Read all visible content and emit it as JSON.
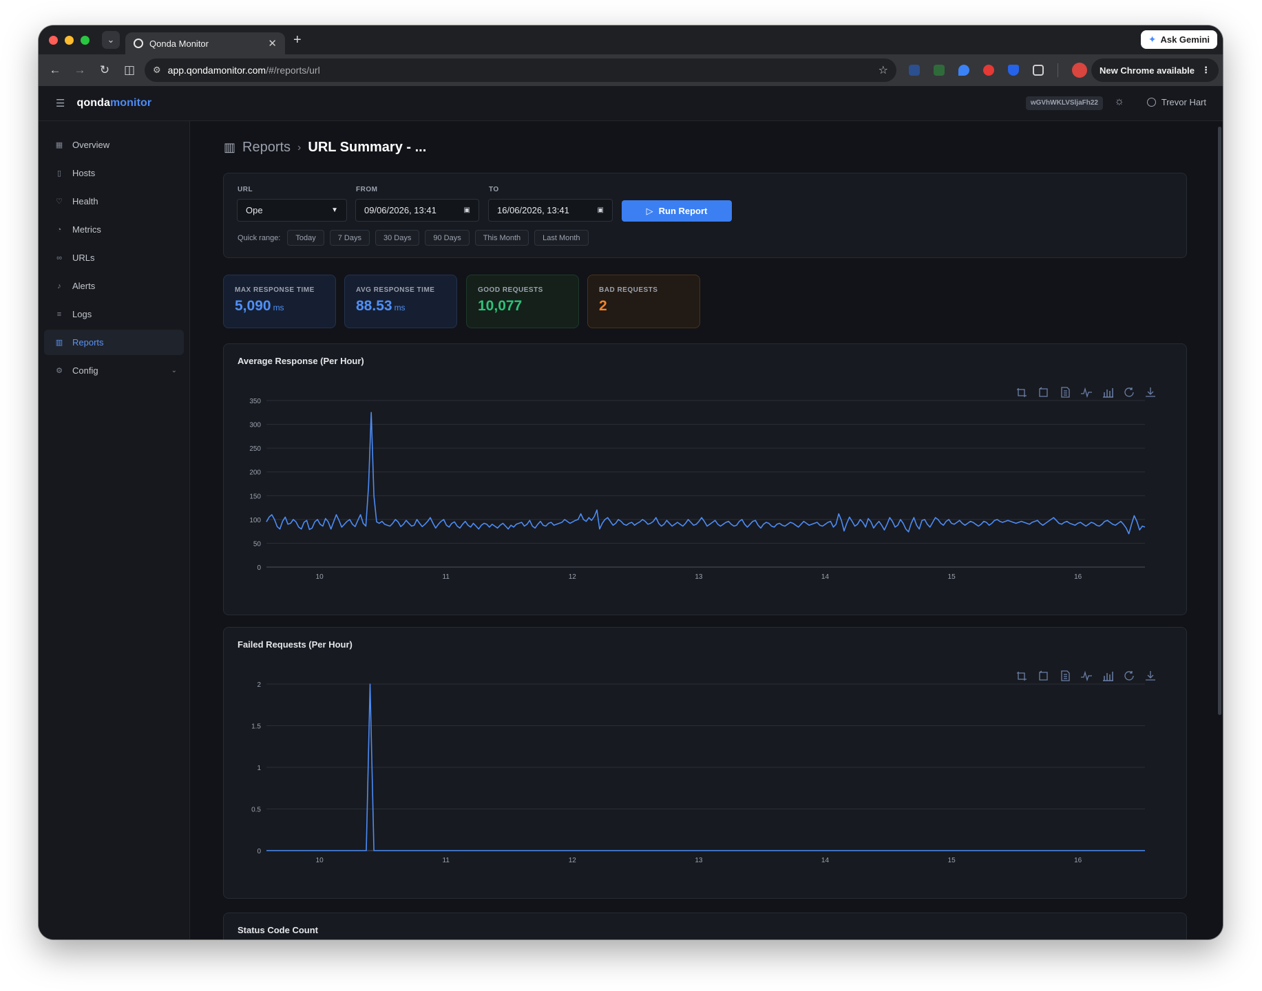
{
  "browser": {
    "tab_title": "Qonda Monitor",
    "url_host": "app.qondamonitor.com",
    "url_path": "/#/reports/url",
    "ask_gemini": "Ask Gemini",
    "new_chrome": "New Chrome available"
  },
  "app": {
    "brand_main": "qonda",
    "brand_accent": "monitor",
    "api_key": "wGVhWKLVSljaFh22",
    "user_name": "Trevor Hart"
  },
  "sidebar": {
    "items": [
      {
        "label": "Overview",
        "icon": "grid-icon"
      },
      {
        "label": "Hosts",
        "icon": "server-icon"
      },
      {
        "label": "Health",
        "icon": "heart-icon"
      },
      {
        "label": "Metrics",
        "icon": "gauge-icon"
      },
      {
        "label": "URLs",
        "icon": "link-icon"
      },
      {
        "label": "Alerts",
        "icon": "bell-icon"
      },
      {
        "label": "Logs",
        "icon": "list-icon"
      },
      {
        "label": "Reports",
        "icon": "bar-chart-icon",
        "active": true
      },
      {
        "label": "Config",
        "icon": "gear-icon"
      }
    ]
  },
  "page": {
    "crumb": "Reports",
    "title": "URL Summary - ..."
  },
  "filters": {
    "url_label": "URL",
    "url_value": "Ope",
    "from_label": "FROM",
    "from_value": "09/06/2026, 13:41",
    "to_label": "TO",
    "to_value": "16/06/2026, 13:41",
    "run_label": "Run Report",
    "quick_label": "Quick range:",
    "quick_ranges": [
      "Today",
      "7 Days",
      "30 Days",
      "90 Days",
      "This Month",
      "Last Month"
    ]
  },
  "stats": [
    {
      "label": "MAX RESPONSE TIME",
      "value": "5,090",
      "unit": "ms"
    },
    {
      "label": "AVG RESPONSE TIME",
      "value": "88.53",
      "unit": "ms"
    },
    {
      "label": "GOOD REQUESTS",
      "value": "10,077",
      "unit": ""
    },
    {
      "label": "BAD REQUESTS",
      "value": "2",
      "unit": ""
    }
  ],
  "colors": {
    "accent": "#3b7ff2",
    "line": "#4d8bf5",
    "good": "#2fc17a",
    "bad": "#f5832b"
  },
  "chart_data": [
    {
      "type": "line",
      "title": "Average Response (Per Hour)",
      "x_ticks": [
        "10",
        "11",
        "12",
        "13",
        "14",
        "15",
        "16"
      ],
      "ylim": [
        0,
        350
      ],
      "y_ticks": [
        0,
        50,
        100,
        150,
        200,
        250,
        300,
        350
      ],
      "grid": true,
      "x_start_day": 9.58,
      "x_end_day": 16.53,
      "series": [
        {
          "values": [
            95,
            105,
            110,
            100,
            85,
            80,
            96,
            105,
            90,
            92,
            100,
            95,
            84,
            80,
            94,
            98,
            79,
            82,
            95,
            100,
            90,
            86,
            102,
            95,
            80,
            95,
            110,
            98,
            84,
            90,
            96,
            100,
            90,
            85,
            98,
            110,
            92,
            86,
            170,
            325,
            150,
            95,
            92,
            96,
            90,
            88,
            86,
            92,
            100,
            95,
            85,
            90,
            98,
            92,
            86,
            88,
            100,
            92,
            85,
            90,
            96,
            104,
            92,
            82,
            90,
            96,
            100,
            88,
            84,
            92,
            95,
            86,
            82,
            90,
            96,
            88,
            84,
            92,
            86,
            80,
            88,
            92,
            90,
            84,
            90,
            86,
            82,
            88,
            92,
            86,
            80,
            88,
            84,
            90,
            92,
            94,
            86,
            90,
            98,
            86,
            82,
            90,
            96,
            88,
            86,
            92,
            94,
            88,
            90,
            92,
            94,
            100,
            96,
            92,
            95,
            98,
            100,
            112,
            100,
            96,
            104,
            98,
            106,
            120,
            80,
            92,
            100,
            104,
            96,
            88,
            92,
            100,
            96,
            90,
            88,
            92,
            94,
            88,
            92,
            95,
            100,
            96,
            90,
            92,
            96,
            104,
            92,
            86,
            90,
            98,
            92,
            86,
            90,
            94,
            90,
            86,
            92,
            100,
            94,
            88,
            90,
            96,
            104,
            96,
            86,
            90,
            94,
            98,
            90,
            86,
            90,
            94,
            96,
            90,
            86,
            88,
            96,
            100,
            90,
            84,
            90,
            96,
            98,
            88,
            82,
            90,
            94,
            92,
            86,
            84,
            90,
            92,
            88,
            86,
            90,
            94,
            92,
            88,
            84,
            90,
            96,
            92,
            88,
            90,
            92,
            94,
            88,
            86,
            90,
            94,
            96,
            84,
            90,
            112,
            98,
            76,
            92,
            105,
            96,
            86,
            90,
            100,
            94,
            84,
            102,
            95,
            82,
            90,
            96,
            88,
            78,
            90,
            104,
            96,
            84,
            88,
            100,
            92,
            80,
            74,
            92,
            104,
            88,
            80,
            98,
            100,
            90,
            84,
            94,
            104,
            100,
            92,
            88,
            96,
            100,
            92,
            90,
            94,
            98,
            92,
            88,
            92,
            96,
            94,
            90,
            86,
            90,
            96,
            94,
            88,
            92,
            98,
            100,
            96,
            94,
            96,
            98,
            96,
            94,
            92,
            94,
            96,
            94,
            92,
            90,
            94,
            96,
            98,
            92,
            88,
            92,
            96,
            100,
            104,
            98,
            92,
            90,
            94,
            96,
            92,
            90,
            88,
            92,
            94,
            90,
            86,
            90,
            94,
            92,
            88,
            86,
            90,
            96,
            98,
            94,
            90,
            88,
            92,
            96,
            90,
            82,
            70,
            90,
            108,
            96,
            78,
            86,
            84
          ]
        }
      ]
    },
    {
      "type": "line",
      "title": "Failed Requests (Per Hour)",
      "x_ticks": [
        "10",
        "11",
        "12",
        "13",
        "14",
        "15",
        "16"
      ],
      "ylim": [
        0,
        2
      ],
      "y_ticks": [
        0,
        0.5,
        1,
        1.5,
        2
      ],
      "grid": true,
      "x_start_day": 9.58,
      "x_end_day": 16.53,
      "series": [
        {
          "spike_day": 10.4,
          "spike_value": 2,
          "baseline": 0
        }
      ]
    }
  ],
  "status_card": {
    "title": "Status Code Count"
  }
}
